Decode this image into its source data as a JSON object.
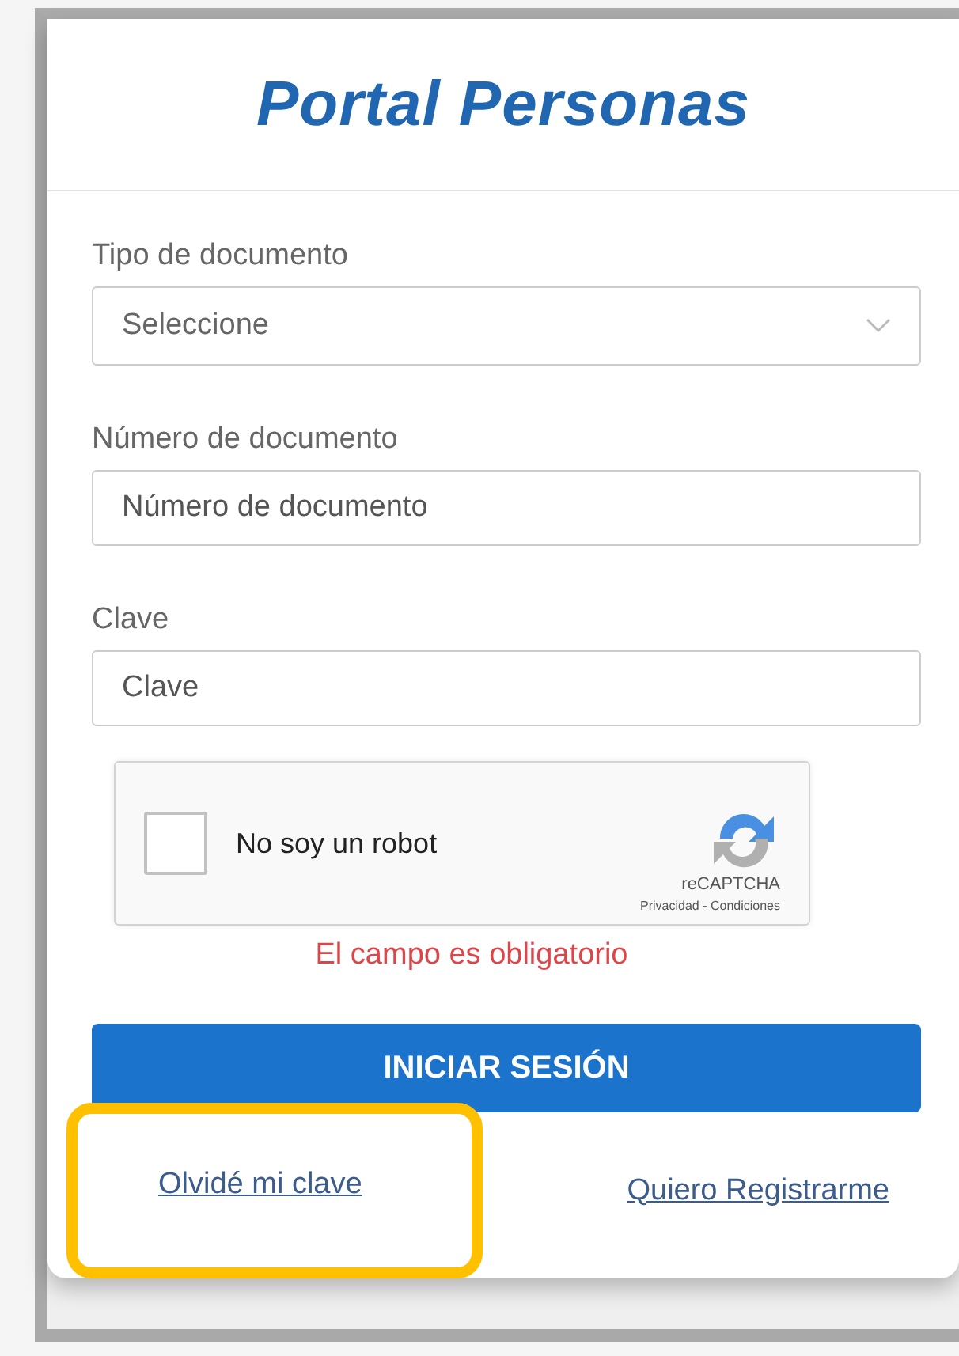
{
  "header": {
    "title": "Portal Personas"
  },
  "fields": [
    {
      "kind": "select",
      "label": "Tipo de documento",
      "placeholder": "Seleccione"
    },
    {
      "kind": "input",
      "label": "Número de documento",
      "placeholder": "Número de documento"
    },
    {
      "kind": "input",
      "label": "Clave",
      "placeholder": "Clave"
    }
  ],
  "captcha": {
    "label": "No soy un robot",
    "checked": false,
    "brand": "reCAPTCHA",
    "terms": "Privacidad - Condiciones",
    "error": "El campo es obligatorio"
  },
  "submit": "INICIAR SESIÓN",
  "links": [
    {
      "label": "Olvidé mi clave",
      "highlighted": true
    },
    {
      "label": "Quiero Registrarme",
      "highlighted": false
    }
  ]
}
